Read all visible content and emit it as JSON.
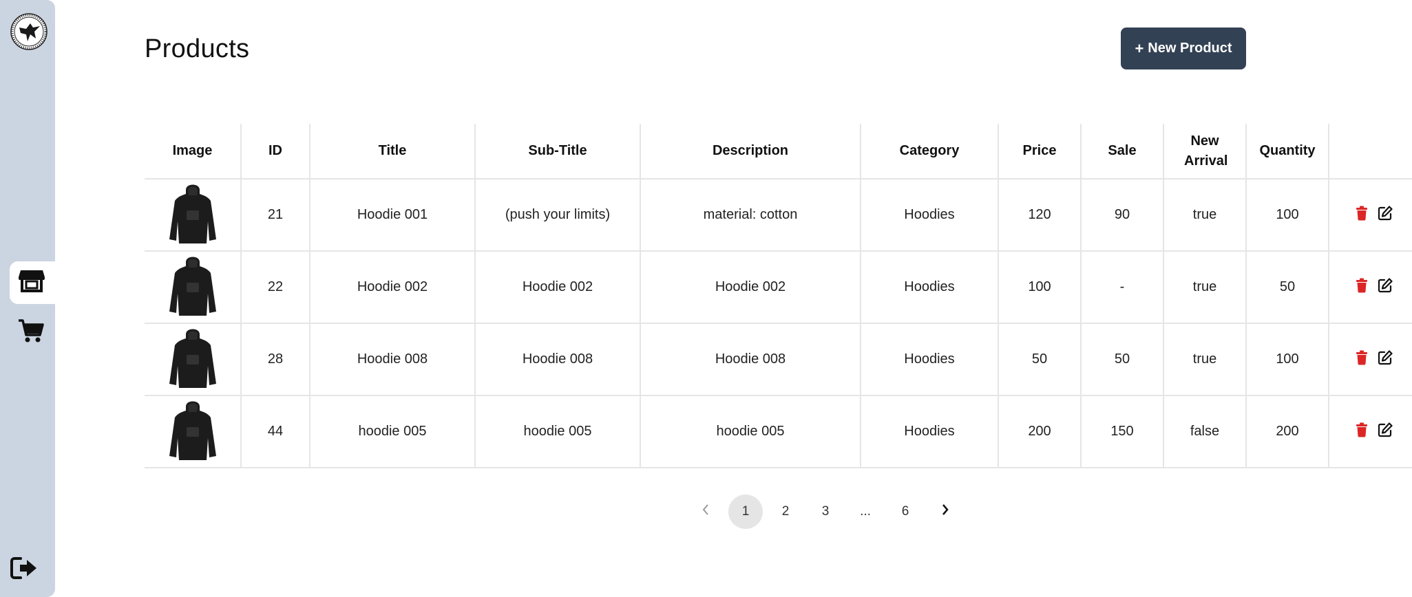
{
  "page": {
    "title": "Products"
  },
  "toolbar": {
    "new_product_label": "New Product",
    "new_product_icon": "plus-icon"
  },
  "sidebar": {
    "logo": "eagle-seal-logo",
    "items": [
      {
        "icon": "store-icon",
        "active": true
      },
      {
        "icon": "cart-icon",
        "active": false
      }
    ],
    "logout_icon": "logout-icon"
  },
  "table": {
    "columns": [
      "Image",
      "ID",
      "Title",
      "Sub-Title",
      "Description",
      "Category",
      "Price",
      "Sale",
      "New Arrival",
      "Quantity",
      ""
    ],
    "rows": [
      {
        "image": "hoodie-thumbnail",
        "id": "21",
        "title": "Hoodie 001",
        "subtitle": "(push your limits)",
        "description": "material: cotton",
        "category": "Hoodies",
        "price": "120",
        "sale": "90",
        "new_arrival": "true",
        "quantity": "100"
      },
      {
        "image": "hoodie-thumbnail",
        "id": "22",
        "title": "Hoodie 002",
        "subtitle": "Hoodie 002",
        "description": "Hoodie 002",
        "category": "Hoodies",
        "price": "100",
        "sale": "-",
        "new_arrival": "true",
        "quantity": "50"
      },
      {
        "image": "hoodie-thumbnail",
        "id": "28",
        "title": "Hoodie 008",
        "subtitle": "Hoodie 008",
        "description": "Hoodie 008",
        "category": "Hoodies",
        "price": "50",
        "sale": "50",
        "new_arrival": "true",
        "quantity": "100"
      },
      {
        "image": "hoodie-thumbnail",
        "id": "44",
        "title": "hoodie 005",
        "subtitle": "hoodie 005",
        "description": "hoodie 005",
        "category": "Hoodies",
        "price": "200",
        "sale": "150",
        "new_arrival": "false",
        "quantity": "200"
      }
    ],
    "row_actions": [
      "trash-icon",
      "edit-icon"
    ]
  },
  "pagination": {
    "pages": [
      "1",
      "2",
      "3",
      "...",
      "6"
    ],
    "current": "1"
  },
  "colors": {
    "sidebar_bg": "#cbd5e1",
    "primary_button": "#334155",
    "delete_red": "#dc2626",
    "border": "#e5e5e5"
  }
}
